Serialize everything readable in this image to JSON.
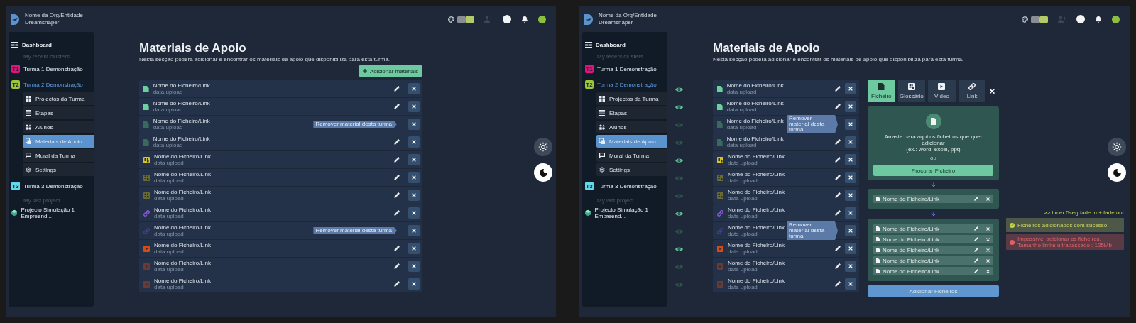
{
  "screens": [
    {
      "header": {
        "org_name": "Nome da Org/Entidade",
        "org_subtitle": "Dreamshaper"
      },
      "sidebar": [
        {
          "kind": "dashboard",
          "label": "Dashboard"
        },
        {
          "kind": "heading",
          "label": "My recent clusters"
        },
        {
          "kind": "cluster",
          "badge": "T1",
          "color": "#e0147c",
          "label": "Turma 1 Demonstração",
          "expanded": false
        },
        {
          "kind": "cluster",
          "badge": "T2",
          "color": "#9cc63b",
          "label": "Turma 2 Demonstração",
          "expanded": true,
          "children": [
            {
              "kind": "projects",
              "label": "Projectos da Turma",
              "selected": false
            },
            {
              "kind": "steps",
              "label": "Etapas",
              "selected": false
            },
            {
              "kind": "students",
              "label": "Alunos",
              "selected": false
            },
            {
              "kind": "materials",
              "label": "Materiais de Apoio",
              "selected": true
            },
            {
              "kind": "wall",
              "label": "Mural da Turma",
              "selected": false
            },
            {
              "kind": "settings",
              "label": "Settings",
              "selected": false
            }
          ]
        },
        {
          "kind": "cluster",
          "badge": "T3",
          "color": "#62d9ea",
          "label": "Turma 3 Demonstração",
          "expanded": false
        },
        {
          "kind": "heading",
          "label": "My last project"
        },
        {
          "kind": "project",
          "label": "Projecto Simulação 1 Empreend..."
        }
      ],
      "page": {
        "title": "Materiais de Apoio",
        "description": "Nesta secção poderá adicionar e encontrar os materiais de apoio que disponibiliza para esta turma."
      },
      "add_button": "Adicionar materiais",
      "show_visibility": false,
      "materials": [
        {
          "kind": "file",
          "name": "Nome do Ficheiro/Link",
          "date": "data upload",
          "visible": true
        },
        {
          "kind": "file",
          "name": "Nome do Ficheiro/Link",
          "date": "data upload",
          "visible": true
        },
        {
          "kind": "file",
          "name": "Nome do Ficheiro/Link",
          "date": "data upload",
          "visible": false,
          "tooltip": "Remover material desta turma"
        },
        {
          "kind": "file",
          "name": "Nome do Ficheiro/Link",
          "date": "data upload",
          "visible": false
        },
        {
          "kind": "glossary",
          "name": "Nome do Ficheiro/Link",
          "date": "data upload",
          "visible": true
        },
        {
          "kind": "glossary",
          "name": "Nome do Ficheiro/Link",
          "date": "data upload",
          "visible": false
        },
        {
          "kind": "glossary",
          "name": "Nome do Ficheiro/Link",
          "date": "data upload",
          "visible": false
        },
        {
          "kind": "link",
          "name": "Nome do Ficheiro/Link",
          "date": "data upload",
          "visible": true
        },
        {
          "kind": "link",
          "name": "Nome do Ficheiro/Link",
          "date": "data upload",
          "visible": false,
          "tooltip": "Remover material desta turma"
        },
        {
          "kind": "video",
          "name": "Nome do Ficheiro/Link",
          "date": "data upload",
          "visible": true
        },
        {
          "kind": "video",
          "name": "Nome do Ficheiro/Link",
          "date": "data upload",
          "visible": false
        },
        {
          "kind": "video",
          "name": "Nome do Ficheiro/Link",
          "date": "data upload",
          "visible": false
        }
      ],
      "theme_buttons": [
        {
          "kind": "light",
          "selected": false
        },
        {
          "kind": "dark",
          "selected": true
        }
      ]
    },
    {
      "header": {
        "org_name": "Nome da Org/Entidade",
        "org_subtitle": "Dreamshaper"
      },
      "sidebar": [
        {
          "kind": "dashboard",
          "label": "Dashboard"
        },
        {
          "kind": "heading",
          "label": "My recent clusters"
        },
        {
          "kind": "cluster",
          "badge": "T1",
          "color": "#e0147c",
          "label": "Turma 1 Demonstração",
          "expanded": false
        },
        {
          "kind": "cluster",
          "badge": "T2",
          "color": "#9cc63b",
          "label": "Turma 2 Demonstração",
          "expanded": true,
          "children": [
            {
              "kind": "projects",
              "label": "Projectos da Turma",
              "selected": false
            },
            {
              "kind": "steps",
              "label": "Etapas",
              "selected": false
            },
            {
              "kind": "students",
              "label": "Alunos",
              "selected": false
            },
            {
              "kind": "materials",
              "label": "Materiais de Apoio",
              "selected": true
            },
            {
              "kind": "wall",
              "label": "Mural da Turma",
              "selected": false
            },
            {
              "kind": "settings",
              "label": "Settings",
              "selected": false
            }
          ]
        },
        {
          "kind": "cluster",
          "badge": "T3",
          "color": "#62d9ea",
          "label": "Turma 3 Demonstração",
          "expanded": false
        },
        {
          "kind": "heading",
          "label": "My last project"
        },
        {
          "kind": "project",
          "label": "Projecto Simulação 1 Empreend..."
        }
      ],
      "page": {
        "title": "Materiais de Apoio",
        "description": "Nesta secção poderá adicionar e encontrar os materiais de apoio que disponibiliza para esta turma."
      },
      "show_visibility": true,
      "materials": [
        {
          "kind": "file",
          "name": "Nome do Ficheiro/Link",
          "date": "data upload",
          "visible": true
        },
        {
          "kind": "file",
          "name": "Nome do Ficheiro/Link",
          "date": "data upload",
          "visible": true
        },
        {
          "kind": "file",
          "name": "Nome do Ficheiro/Link",
          "date": "data upload",
          "visible": false,
          "tooltip": "Remover material desta turma"
        },
        {
          "kind": "file",
          "name": "Nome do Ficheiro/Link",
          "date": "data upload",
          "visible": false
        },
        {
          "kind": "glossary",
          "name": "Nome do Ficheiro/Link",
          "date": "data upload",
          "visible": true
        },
        {
          "kind": "glossary",
          "name": "Nome do Ficheiro/Link",
          "date": "data upload",
          "visible": false
        },
        {
          "kind": "glossary",
          "name": "Nome do Ficheiro/Link",
          "date": "data upload",
          "visible": false
        },
        {
          "kind": "link",
          "name": "Nome do Ficheiro/Link",
          "date": "data upload",
          "visible": true
        },
        {
          "kind": "link",
          "name": "Nome do Ficheiro/Link",
          "date": "data upload",
          "visible": false,
          "tooltip": "Remover material desta turma"
        },
        {
          "kind": "video",
          "name": "Nome do Ficheiro/Link",
          "date": "data upload",
          "visible": true
        },
        {
          "kind": "video",
          "name": "Nome do Ficheiro/Link",
          "date": "data upload",
          "visible": false
        },
        {
          "kind": "video",
          "name": "Nome do Ficheiro/Link",
          "date": "data upload",
          "visible": false
        }
      ],
      "upload_panel": {
        "tabs": [
          {
            "kind": "file",
            "label": "Ficheiro",
            "selected": true
          },
          {
            "kind": "glossary",
            "label": "Glossário",
            "selected": false
          },
          {
            "kind": "video",
            "label": "Vídeo",
            "selected": false
          },
          {
            "kind": "link",
            "label": "Link",
            "selected": false
          }
        ],
        "dropzone": {
          "instructions": [
            "Arraste para aqui os ficheiros que quer adicionar",
            "(ex.: word, excel, ppt)"
          ],
          "separator": "ou",
          "browse_button": "Procurar Ficheiro"
        },
        "pending_files": [
          "Nome do Ficheiro/Link"
        ],
        "added_files": [
          "Nome do Ficheiro/Link",
          "Nome do Ficheiro/Link",
          "Nome do Ficheiro/Link",
          "Nome do Ficheiro/Link",
          "Nome do Ficheiro/Link"
        ],
        "submit_button": "Adicionar Ficheiros"
      },
      "notes": {
        "annotation": ">> timer 5seg fade in + fade out",
        "toasts": [
          {
            "kind": "success",
            "lines": [
              "Ficheiros adicionados com sucesso."
            ]
          },
          {
            "kind": "error",
            "lines": [
              "Impossível adicionar os ficheiros.",
              "Tamanho limite ultrapassado : 125Mb"
            ]
          }
        ]
      },
      "theme_buttons": [
        {
          "kind": "light",
          "selected": false
        },
        {
          "kind": "dark",
          "selected": true
        }
      ]
    }
  ]
}
